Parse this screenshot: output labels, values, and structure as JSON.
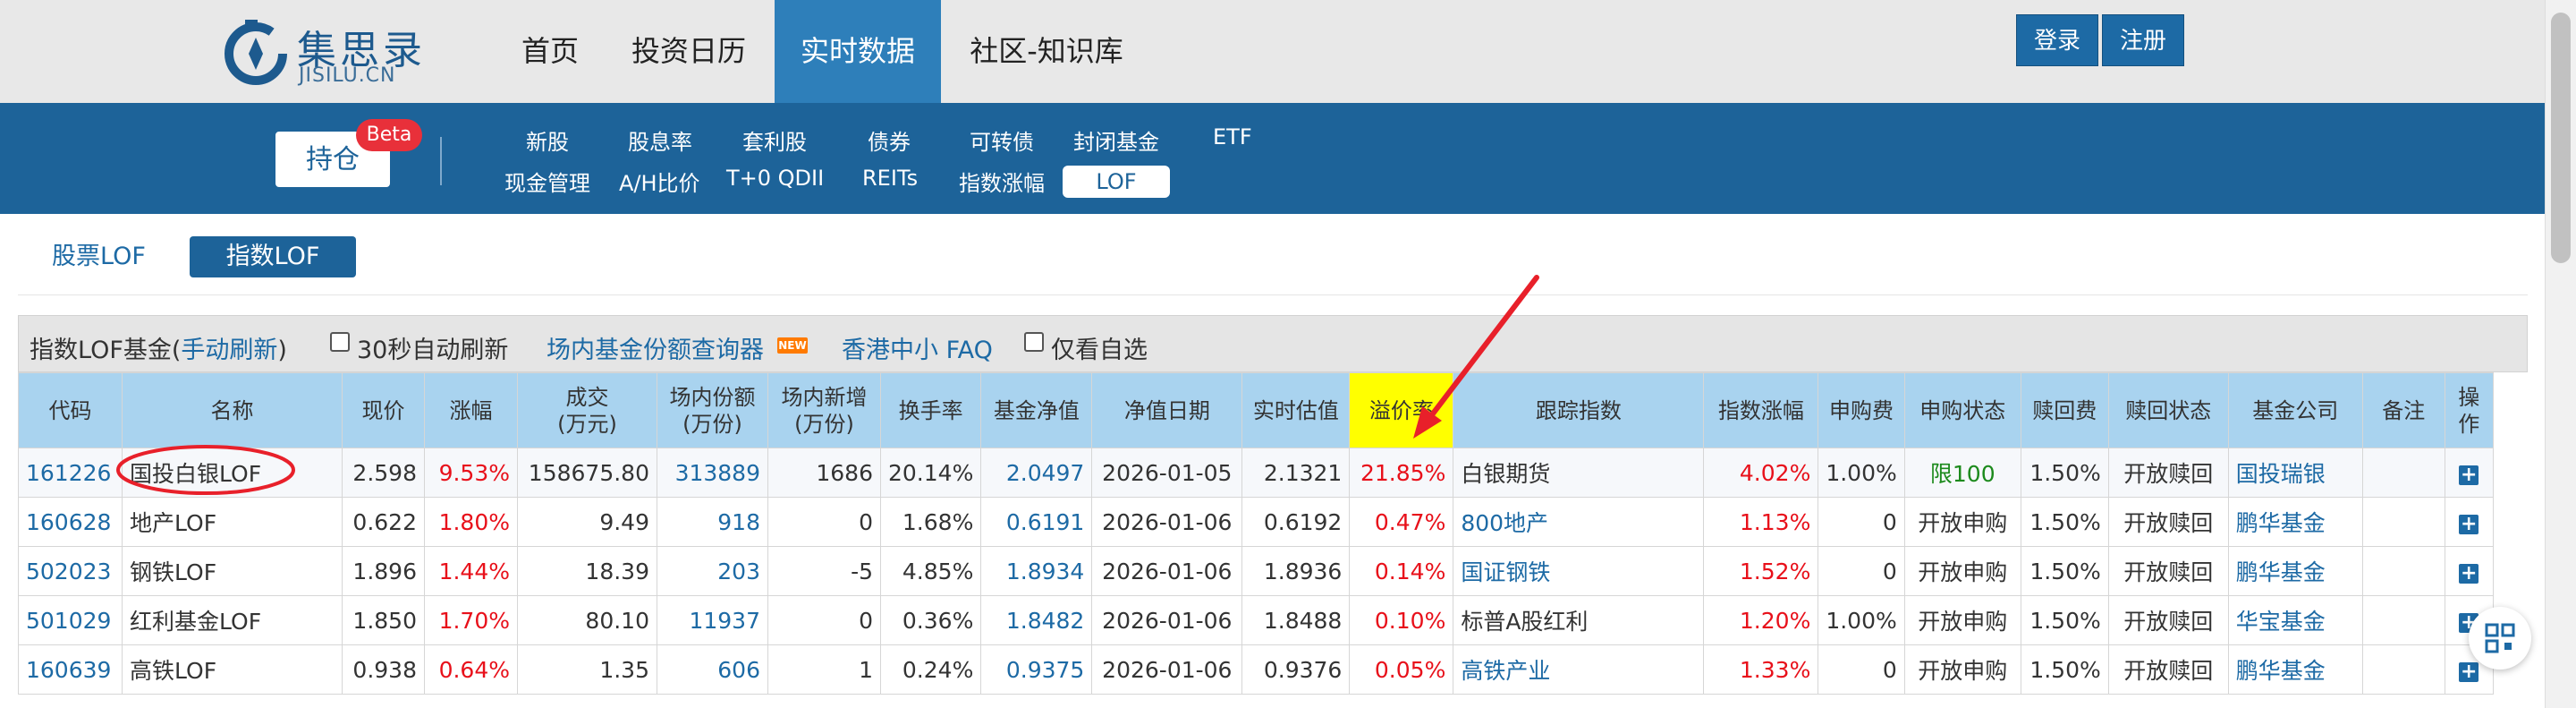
{
  "header": {
    "logo_cn": "集思录",
    "logo_en": "JISILU.CN",
    "nav": [
      "首页",
      "投资日历",
      "实时数据",
      "社区-知识库"
    ],
    "active_nav": "实时数据",
    "login": "登录",
    "register": "注册"
  },
  "subnav": {
    "hold_label": "持仓",
    "beta_badge": "Beta",
    "row1": [
      "新股",
      "股息率",
      "套利股",
      "债券",
      "可转债",
      "封闭基金",
      "ETF"
    ],
    "row2": [
      "现金管理",
      "A/H比价",
      "T+0 QDII",
      "REITs",
      "指数涨幅",
      "LOF"
    ],
    "active_item": "LOF"
  },
  "tabs": {
    "stock": "股票LOF",
    "index": "指数LOF"
  },
  "toolbar": {
    "title": "指数LOF基金(",
    "refresh": "手动刷新",
    "title_close": ")",
    "auto_refresh": "30秒自动刷新",
    "share_query": "场内基金份额查询器",
    "new_tag": "NEW",
    "hk_faq": "香港中小 FAQ",
    "watch_only": "仅看自选"
  },
  "table": {
    "headers": [
      "代码",
      "名称",
      "现价",
      "涨幅",
      "成交\n(万元)",
      "场内份额\n(万份)",
      "场内新增\n(万份)",
      "换手率",
      "基金净值",
      "净值日期",
      "实时估值",
      "溢价率",
      "跟踪指数",
      "指数涨幅",
      "申购费",
      "申购状态",
      "赎回费",
      "赎回状态",
      "基金公司",
      "备注",
      "操作"
    ],
    "highlight_header": "溢价率",
    "rows": [
      {
        "code": "161226",
        "name": "国投白银LOF",
        "price": "2.598",
        "change": "9.53%",
        "volume": "158675.80",
        "shares": "313889",
        "new_shares": "1686",
        "turnover": "20.14%",
        "nav": "2.0497",
        "nav_date": "2026-01-05",
        "est": "2.1321",
        "premium": "21.85%",
        "index": "白银期货",
        "index_change": "4.02%",
        "buy_fee": "1.00%",
        "buy_status": "限100",
        "redeem_fee": "1.50%",
        "redeem_status": "开放赎回",
        "company": "国投瑞银",
        "note": "",
        "op": "+"
      },
      {
        "code": "160628",
        "name": "地产LOF",
        "price": "0.622",
        "change": "1.80%",
        "volume": "9.49",
        "shares": "918",
        "new_shares": "0",
        "turnover": "1.68%",
        "nav": "0.6191",
        "nav_date": "2026-01-06",
        "est": "0.6192",
        "premium": "0.47%",
        "index": "800地产",
        "index_change": "1.13%",
        "buy_fee": "0",
        "buy_status": "开放申购",
        "redeem_fee": "1.50%",
        "redeem_status": "开放赎回",
        "company": "鹏华基金",
        "note": "",
        "op": "+"
      },
      {
        "code": "502023",
        "name": "钢铁LOF",
        "price": "1.896",
        "change": "1.44%",
        "volume": "18.39",
        "shares": "203",
        "new_shares": "-5",
        "turnover": "4.85%",
        "nav": "1.8934",
        "nav_date": "2026-01-06",
        "est": "1.8936",
        "premium": "0.14%",
        "index": "国证钢铁",
        "index_change": "1.52%",
        "buy_fee": "0",
        "buy_status": "开放申购",
        "redeem_fee": "1.50%",
        "redeem_status": "开放赎回",
        "company": "鹏华基金",
        "note": "",
        "op": "+"
      },
      {
        "code": "501029",
        "name": "红利基金LOF",
        "price": "1.850",
        "change": "1.70%",
        "volume": "80.10",
        "shares": "11937",
        "new_shares": "0",
        "turnover": "0.36%",
        "nav": "1.8482",
        "nav_date": "2026-01-06",
        "est": "1.8488",
        "premium": "0.10%",
        "index": "标普A股红利",
        "index_change": "1.20%",
        "buy_fee": "1.00%",
        "buy_status": "开放申购",
        "redeem_fee": "1.50%",
        "redeem_status": "开放赎回",
        "company": "华宝基金",
        "note": "",
        "op": "+"
      },
      {
        "code": "160639",
        "name": "高铁LOF",
        "price": "0.938",
        "change": "0.64%",
        "volume": "1.35",
        "shares": "606",
        "new_shares": "1",
        "turnover": "0.24%",
        "nav": "0.9375",
        "nav_date": "2026-01-06",
        "est": "0.9376",
        "premium": "0.05%",
        "index": "高铁产业",
        "index_change": "1.33%",
        "buy_fee": "0",
        "buy_status": "开放申购",
        "redeem_fee": "1.50%",
        "redeem_status": "开放赎回",
        "company": "鹏华基金",
        "note": "",
        "op": "+"
      }
    ]
  },
  "annotation": {
    "circle_target": "国投白银LOF",
    "arrow_target": "溢价率",
    "color": "#e8202a"
  },
  "colors": {
    "brand_blue": "#1d6399",
    "link_blue": "#1d6aa5",
    "header_cell": "#a9d3ef",
    "highlight": "#ffff00",
    "up_red": "#e8101a",
    "limit_green": "#1c8a1c"
  }
}
